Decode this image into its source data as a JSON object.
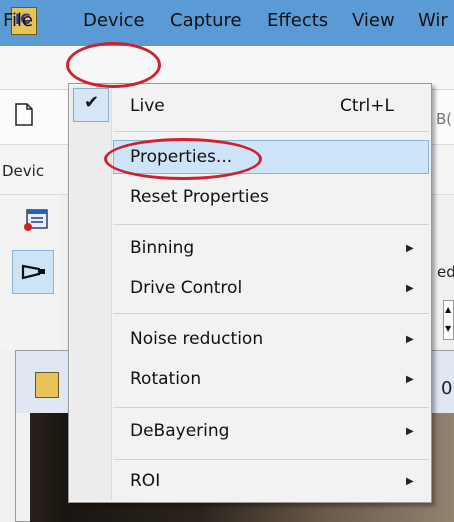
{
  "app": {
    "icon_text": "IC"
  },
  "menubar": {
    "items": [
      "File",
      "Device",
      "Capture",
      "Effects",
      "View",
      "Wir"
    ]
  },
  "toolbar": {
    "partial_right_1": "B(",
    "device_label": "Devic",
    "partial_right_2": "ed",
    "partial_right_3": "0"
  },
  "device_menu": {
    "items": [
      {
        "label": "Live",
        "shortcut": "Ctrl+L",
        "checked": true
      },
      {
        "label": "Properties...",
        "highlighted": true
      },
      {
        "label": "Reset Properties"
      },
      {
        "label": "Binning",
        "submenu": true
      },
      {
        "label": "Drive Control",
        "submenu": true
      },
      {
        "label": "Noise reduction",
        "submenu": true
      },
      {
        "label": "Rotation",
        "submenu": true
      },
      {
        "label": "DeBayering",
        "submenu": true
      },
      {
        "label": "ROI",
        "submenu": true
      }
    ]
  },
  "colors": {
    "titlebar": "#5b9bd5",
    "highlight": "#cde3f7",
    "annotation": "#d0202a"
  }
}
